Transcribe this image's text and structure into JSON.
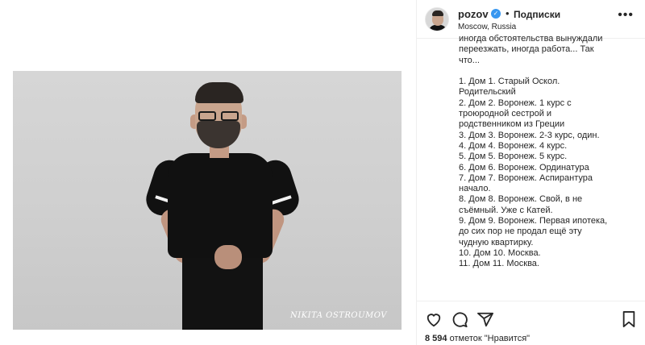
{
  "header": {
    "username": "pozov",
    "dot": "•",
    "follow_label": "Подписки",
    "location": "Moscow, Russia"
  },
  "photo": {
    "watermark": "NIKITA OSTROUMOV"
  },
  "caption": {
    "lines": [
      "иногда обстоятельства вынуждали",
      "переезжать, иногда работа... Так",
      "что...",
      "",
      "1. Дом 1. Старый Оскол.",
      "Родительский",
      "2. Дом 2. Воронеж. 1 курс с",
      "троюродной сестрой и",
      "родственником из Греции",
      "3. Дом 3. Воронеж. 2-3 курс, один.",
      "4. Дом 4. Воронеж. 4 курс.",
      "5. Дом 5. Воронеж. 5 курс.",
      "6. Дом 6. Воронеж. Ординатура",
      "7. Дом 7. Воронеж. Аспирантура",
      "начало.",
      "8. Дом 8. Воронеж. Свой, в не",
      "съёмный. Уже с Катей.",
      "9. Дом 9. Воронеж. Первая ипотека,",
      "до сих пор не продал ещё эту",
      "чудную квартирку.",
      "10. Дом 10. Москва.",
      "11. Дом 11. Москва."
    ]
  },
  "likes": {
    "count": "8 594",
    "label": "отметок \"Нравится\""
  },
  "icons": {
    "like": "heart-icon",
    "comment": "comment-icon",
    "share": "share-icon",
    "save": "bookmark-icon",
    "more": "more-icon",
    "verified": "verified-badge-icon"
  },
  "colors": {
    "verified": "#3897f0",
    "text": "#262626",
    "divider": "#efefef"
  }
}
